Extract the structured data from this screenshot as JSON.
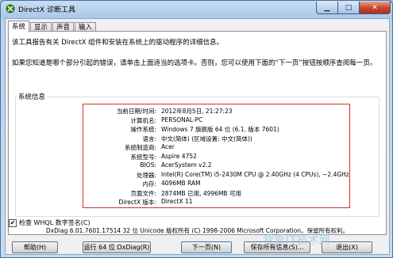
{
  "window": {
    "title": "DirectX 诊断工具"
  },
  "tabs": [
    "系统",
    "显示",
    "声音",
    "输入"
  ],
  "intro": {
    "line1": "该工具报告有关 DirectX 组件和安装在系统上的驱动程序的详细信息。",
    "line2": "如果您知道是哪个部分引起的错误，请单击上面适当的选项卡。否则，您可以使用下面的“下一页”按钮按顺序查阅每一页。"
  },
  "system_info": {
    "title": "系统信息",
    "rows": [
      {
        "label": "当前日期/时间:",
        "value": "2012年8月5日, 21:27:23"
      },
      {
        "label": "计算机名:",
        "value": "PERSONAL-PC"
      },
      {
        "label": "操作系统:",
        "value": "Windows 7 旗舰版 64 位 (6.1, 版本 7601)"
      },
      {
        "label": "语言:",
        "value": "中文(简体) (区域设置: 中文(简体))"
      },
      {
        "label": "系统制造商:",
        "value": "Acer"
      },
      {
        "label": "系统型号:",
        "value": "Aspire 4752"
      },
      {
        "label": "BIOS:",
        "value": "AcerSystem v2.2"
      },
      {
        "label": "处理器:",
        "value": "Intel(R) Core(TM) i5-2430M CPU @ 2.40GHz (4 CPUs), ~2.4GHz"
      },
      {
        "label": "内存:",
        "value": "4096MB RAM"
      },
      {
        "label": "页面文件:",
        "value": "2874MB 已用, 4996MB 可用"
      },
      {
        "label": "DirectX 版本:",
        "value": "DirectX 11"
      }
    ]
  },
  "whql": {
    "label": "检查 WHQL 数字签名(C)",
    "checked": true
  },
  "footer": {
    "text": "DxDiag 6.01.7601.17514 32 位 Unicode 版权所有 (C) 1998-2006 Microsoft Corporation。保留所有权利。"
  },
  "buttons": {
    "help": "帮助(H)",
    "run64": "运行 64 位 DxDiag(R)",
    "next": "下一页(N)",
    "save": "保存所有信息(S)...",
    "exit": "退出(X)"
  },
  "watermark": "我爱IT技术网"
}
